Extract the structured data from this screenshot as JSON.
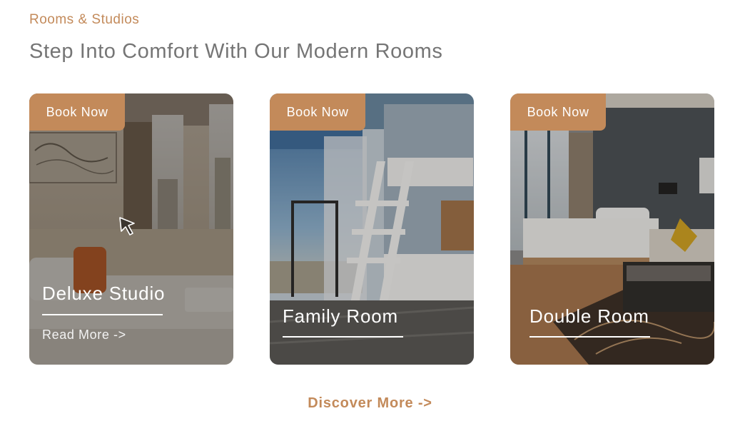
{
  "section": {
    "eyebrow": "Rooms & Studios",
    "heading": "Step Into Comfort With Our Modern Rooms"
  },
  "rooms": [
    {
      "book_label": "Book Now",
      "title": "Deluxe Studio",
      "read_more": "Read More ->",
      "image": "deluxe-studio-photo"
    },
    {
      "book_label": "Book Now",
      "title": "Family Room",
      "image": "family-room-photo"
    },
    {
      "book_label": "Book Now",
      "title": "Double Room",
      "image": "double-room-photo"
    }
  ],
  "discover_more": "Discover More ->",
  "colors": {
    "accent": "#c38a5a",
    "heading": "#757575",
    "white": "#ffffff"
  }
}
